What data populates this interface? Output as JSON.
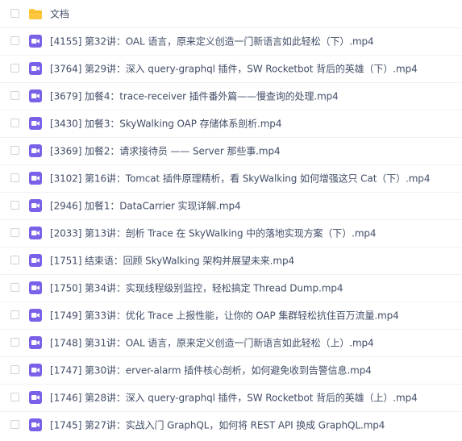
{
  "folder": {
    "name": "文档",
    "icon": "folder-icon",
    "color": "#fcc73d"
  },
  "files": [
    {
      "name": "[4155] 第32讲：OAL 语言，原来定义创造一门新语言如此轻松（下）.mp4",
      "icon": "video-file-icon"
    },
    {
      "name": "[3764] 第29讲：深入 query-graphql 插件，SW Rocketbot 背后的英雄（下）.mp4",
      "icon": "video-file-icon"
    },
    {
      "name": "[3679] 加餐4：trace-receiver 插件番外篇——慢查询的处理.mp4",
      "icon": "video-file-icon"
    },
    {
      "name": "[3430] 加餐3：SkyWalking OAP 存储体系剖析.mp4",
      "icon": "video-file-icon"
    },
    {
      "name": "[3369] 加餐2：请求接待员 —— Server 那些事.mp4",
      "icon": "video-file-icon"
    },
    {
      "name": "[3102] 第16讲：Tomcat 插件原理精析，看 SkyWalking 如何增强这只 Cat（下）.mp4",
      "icon": "video-file-icon"
    },
    {
      "name": "[2946] 加餐1：DataCarrier 实现详解.mp4",
      "icon": "video-file-icon"
    },
    {
      "name": "[2033] 第13讲：剖析 Trace 在 SkyWalking 中的落地实现方案（下）.mp4",
      "icon": "video-file-icon"
    },
    {
      "name": "[1751] 结束语：回顾 SkyWalking 架构并展望未来.mp4",
      "icon": "video-file-icon"
    },
    {
      "name": "[1750] 第34讲：实现线程级别监控，轻松搞定 Thread Dump.mp4",
      "icon": "video-file-icon"
    },
    {
      "name": "[1749] 第33讲：优化 Trace 上报性能，让你的 OAP 集群轻松抗住百万流量.mp4",
      "icon": "video-file-icon"
    },
    {
      "name": "[1748] 第31讲：OAL 语言，原来定义创造一门新语言如此轻松（上）.mp4",
      "icon": "video-file-icon"
    },
    {
      "name": "[1747] 第30讲：erver-alarm 插件核心剖析，如何避免收到告警信息.mp4",
      "icon": "video-file-icon"
    },
    {
      "name": "[1746] 第28讲：深入 query-graphql 插件，SW Rocketbot 背后的英雄（上）.mp4",
      "icon": "video-file-icon"
    },
    {
      "name": "[1745] 第27讲：实战入门 GraphQL，如何将 REST API 换成 GraphQL.mp4",
      "icon": "video-file-icon"
    }
  ],
  "colors": {
    "video_icon": "#7b61e8",
    "text": "#424e67",
    "checkbox_border": "#cfd2d8"
  }
}
